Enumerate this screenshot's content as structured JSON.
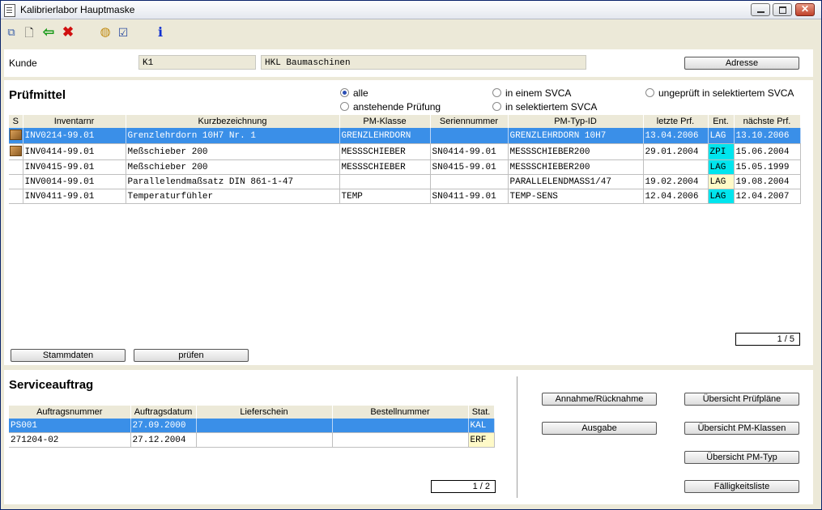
{
  "window": {
    "title": "Kalibrierlabor Hauptmaske"
  },
  "customer": {
    "label": "Kunde",
    "code": "K1",
    "name": "HKL Baumaschinen",
    "address_button": "Adresse"
  },
  "pruefmittel": {
    "title": "Prüfmittel",
    "filters": [
      {
        "label": "alle",
        "selected": true
      },
      {
        "label": "in einem SVCA",
        "selected": false
      },
      {
        "label": "ungeprüft in selektiertem SVCA",
        "selected": false
      },
      {
        "label": "anstehende Prüfung",
        "selected": false
      },
      {
        "label": "in selektiertem SVCA",
        "selected": false
      }
    ],
    "columns": [
      "S",
      "Inventarnr",
      "Kurzbezeichnung",
      "PM-Klasse",
      "Seriennummer",
      "PM-Typ-ID",
      "letzte Prf.",
      "Ent.",
      "nächste Prf."
    ],
    "rows": [
      {
        "s": "box-icon",
        "inventar": "INV0214-99.01",
        "kurz": "Grenzlehrdorn 10H7 Nr. 1",
        "klasse": "GRENZLEHRDORN",
        "serie": "",
        "typ": "GRENZLEHRDORN 10H7",
        "letzte": "13.04.2006",
        "ent": "LAG",
        "naechste": "13.10.2006",
        "selected": true
      },
      {
        "s": "box-icon",
        "inventar": "INV0414-99.01",
        "kurz": "Meßschieber 200",
        "klasse": "MESSSCHIEBER",
        "serie": "SN0414-99.01",
        "typ": "MESSSCHIEBER200",
        "letzte": "29.01.2004",
        "ent": "ZPI",
        "naechste": "15.06.2004",
        "selected": false
      },
      {
        "s": "",
        "inventar": "INV0415-99.01",
        "kurz": "Meßschieber 200",
        "klasse": "MESSSCHIEBER",
        "serie": "SN0415-99.01",
        "typ": "MESSSCHIEBER200",
        "letzte": "",
        "ent": "LAG",
        "naechste": "15.05.1999",
        "selected": false
      },
      {
        "s": "",
        "inventar": "INV0014-99.01",
        "kurz": "Parallelendmaßsatz DIN 861-1-47",
        "klasse": "",
        "serie": "",
        "typ": "PARALLELENDMASS1/47",
        "letzte": "19.02.2004",
        "ent": "LAG",
        "naechste": "19.08.2004",
        "selected": false
      },
      {
        "s": "",
        "inventar": "INV0411-99.01",
        "kurz": "Temperaturfühler",
        "klasse": "TEMP",
        "serie": "SN0411-99.01",
        "typ": "TEMP-SENS",
        "letzte": "12.04.2006",
        "ent": "LAG",
        "naechste": "12.04.2007",
        "selected": false
      }
    ],
    "ent_colors": [
      "cyan",
      "cyan",
      "cyan",
      "yellow",
      "cyan"
    ],
    "pager": "1 / 5",
    "buttons": {
      "stammdaten": "Stammdaten",
      "pruefen": "prüfen"
    }
  },
  "serviceauftrag": {
    "title": "Serviceauftrag",
    "columns": [
      "Auftragsnummer",
      "Auftragsdatum",
      "Lieferschein",
      "Bestellnummer",
      "Stat."
    ],
    "rows": [
      {
        "nummer": "PS001",
        "datum": "27.09.2000",
        "liefer": "",
        "bestell": "",
        "stat": "KAL",
        "selected": true
      },
      {
        "nummer": "271204-02",
        "datum": "27.12.2004",
        "liefer": "",
        "bestell": "",
        "stat": "ERF",
        "selected": false
      }
    ],
    "pager": "1 / 2"
  },
  "actions": {
    "annahme": "Annahme/Rücknahme",
    "ausgabe": "Ausgabe",
    "uebersicht_pruefplaene": "Übersicht Prüfpläne",
    "uebersicht_pm_klassen": "Übersicht PM-Klassen",
    "uebersicht_pm_typ": "Übersicht PM-Typ",
    "faelligkeitsliste": "Fälligkeitsliste"
  },
  "toolbar_icons": [
    "find-records-icon",
    "new-document-icon",
    "back-arrow-icon",
    "delete-x-icon",
    "calibrate-icon",
    "edit-chart-icon",
    "info-icon"
  ],
  "colors": {
    "selection": "#3a8fe8",
    "status_cyan": "#00e5ee",
    "status_yellow": "#fffac8"
  }
}
